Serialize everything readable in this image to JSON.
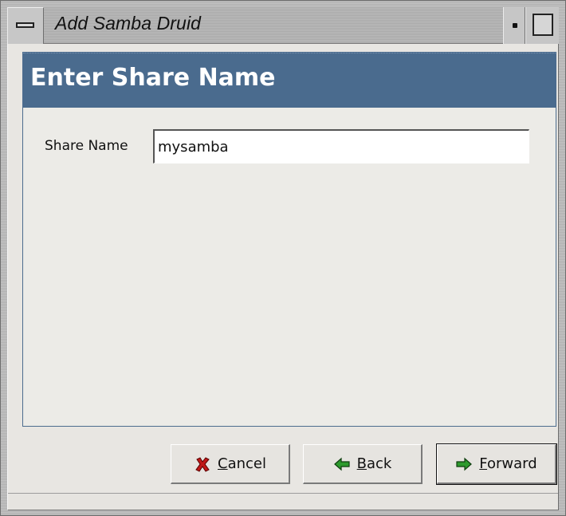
{
  "window": {
    "title": "Add Samba Druid"
  },
  "druid": {
    "header_title": "Enter Share Name",
    "share_name_label": "Share Name",
    "share_name_value": "mysamba"
  },
  "buttons": {
    "cancel": {
      "label_prefix": "",
      "label_mnemonic": "C",
      "label_rest": "ancel",
      "icon": "cancel-x-icon"
    },
    "back": {
      "label_prefix": "",
      "label_mnemonic": "B",
      "label_rest": "ack",
      "icon": "arrow-left-icon"
    },
    "forward": {
      "label_prefix": "",
      "label_mnemonic": "F",
      "label_rest": "orward",
      "icon": "arrow-right-icon"
    }
  },
  "colors": {
    "header_bg": "#4a6b8e",
    "cancel_icon": "#c01818",
    "arrow_icon": "#2d9a2d"
  }
}
